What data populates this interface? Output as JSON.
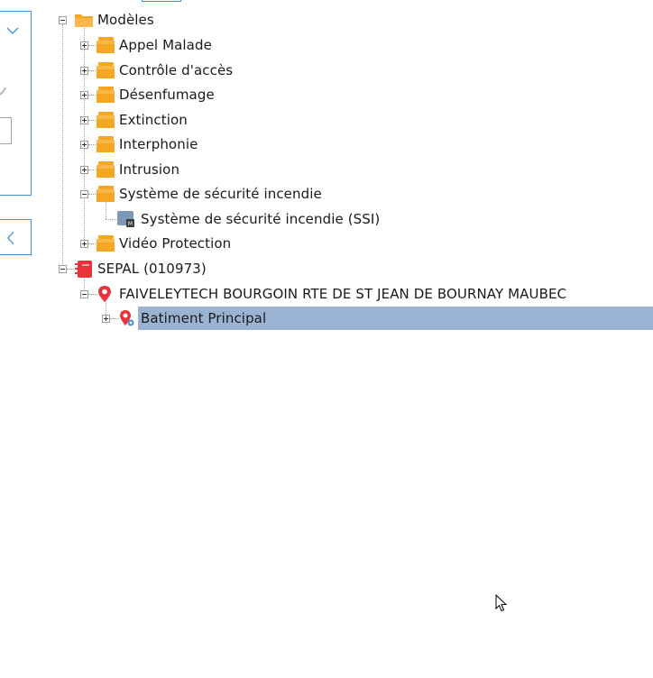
{
  "colors": {
    "accent_border": "#3d8fd6",
    "selection_bg": "#9bb3d2",
    "folder": "#f5a623",
    "marker_red": "#e8333c"
  },
  "left_panel": {
    "icons": [
      "chevron-down-icon",
      "chevron-left-icon"
    ]
  },
  "tree": {
    "root_models": {
      "label": "Modèles",
      "expanded": true,
      "children": [
        {
          "label": "Appel Malade",
          "icon": "folder-stack-icon",
          "expanded": false
        },
        {
          "label": "Contrôle d'accès",
          "icon": "folder-stack-icon",
          "expanded": false
        },
        {
          "label": "Désenfumage",
          "icon": "folder-stack-icon",
          "expanded": false
        },
        {
          "label": "Extinction",
          "icon": "folder-stack-icon",
          "expanded": false
        },
        {
          "label": "Interphonie",
          "icon": "folder-stack-icon",
          "expanded": false
        },
        {
          "label": "Intrusion",
          "icon": "folder-stack-icon",
          "expanded": false
        },
        {
          "label": "Système de sécurité incendie",
          "icon": "folder-stack-icon",
          "expanded": true,
          "children": [
            {
              "label": "Système de sécurité incendie (SSI)",
              "icon": "module-icon"
            }
          ]
        },
        {
          "label": "Vidéo Protection",
          "icon": "folder-stack-icon",
          "expanded": false
        }
      ]
    },
    "client": {
      "label": "SEPAL (010973)",
      "expanded": true,
      "site": {
        "label": "FAIVELEYTECH BOURGOIN RTE DE ST JEAN DE BOURNAY MAUBEC",
        "expanded": true,
        "building": {
          "label": "Batiment Principal",
          "expanded": false,
          "selected": true
        }
      }
    }
  }
}
